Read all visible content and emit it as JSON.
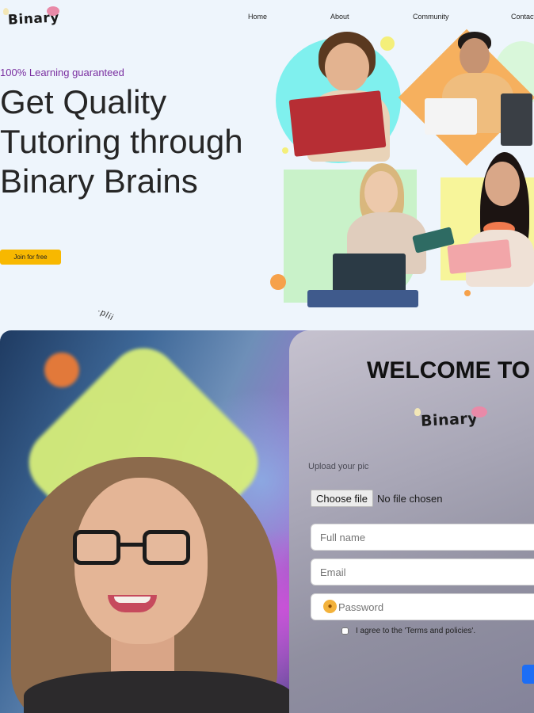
{
  "brand": {
    "logo_text": "Binary"
  },
  "nav": {
    "home": "Home",
    "about": "About",
    "community": "Community",
    "contact": "Contact"
  },
  "hero": {
    "tagline": "100% Learning guaranteed",
    "title": "Get Quality Tutoring through Binary Brains",
    "cta_label": "Join for free"
  },
  "curl_text": "·plii",
  "signup": {
    "welcome": "WELCOME TO",
    "logo_text": "Binary",
    "upload_label": "Upload your pic",
    "choose_file_label": "Choose file",
    "no_file_text": "No file chosen",
    "full_name_placeholder": "Full name",
    "email_placeholder": "Email",
    "password_placeholder": "Password",
    "agree_text": "I agree to the 'Terms and policies'."
  },
  "colors": {
    "accent": "#f8b800",
    "tagline": "#7a2fa0",
    "submit": "#1d6ef5"
  }
}
